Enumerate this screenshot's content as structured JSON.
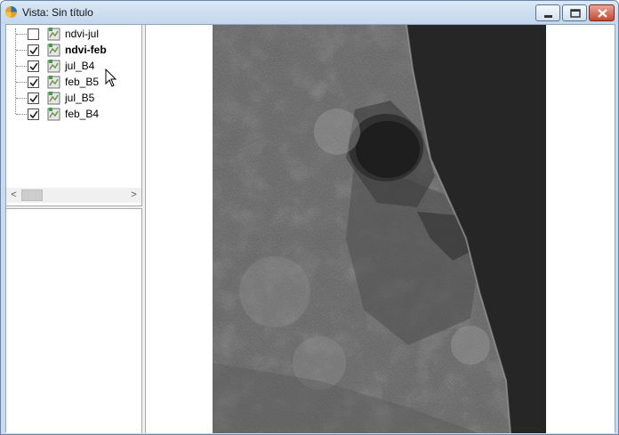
{
  "window": {
    "title": "Vista: Sin título"
  },
  "toc": {
    "layers": [
      {
        "label": "ndvi-jul",
        "checked": false,
        "bold": false
      },
      {
        "label": "ndvi-feb",
        "checked": true,
        "bold": true
      },
      {
        "label": "jul_B4",
        "checked": true,
        "bold": false
      },
      {
        "label": "feb_B5",
        "checked": true,
        "bold": false
      },
      {
        "label": "jul_B5",
        "checked": true,
        "bold": false
      },
      {
        "label": "feb_B4",
        "checked": true,
        "bold": false
      }
    ],
    "scroll_left": "<",
    "scroll_right": ">"
  },
  "icons": {
    "app": "gvsig-app-icon",
    "layer": "raster-layer-icon",
    "cursor": "mouse-pointer-icon"
  },
  "colors": {
    "sea": "#2a2a2a",
    "land": "#6b6b6b"
  }
}
